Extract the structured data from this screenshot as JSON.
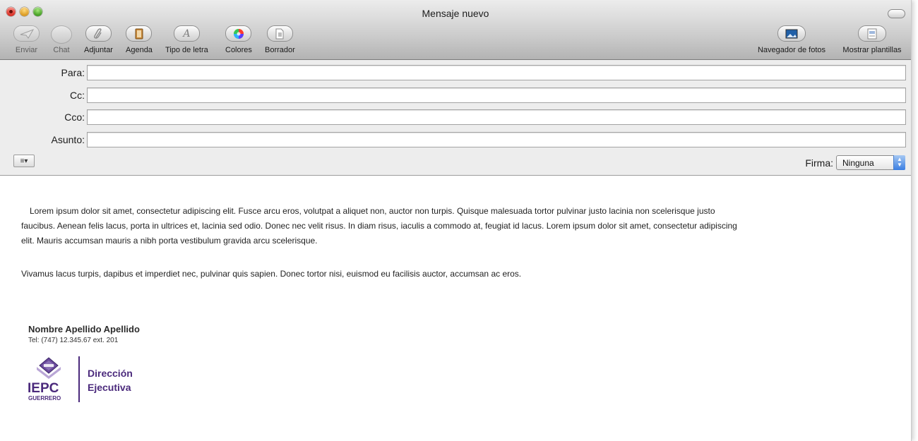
{
  "window": {
    "title": "Mensaje nuevo"
  },
  "toolbar": {
    "left": [
      {
        "label": "Enviar",
        "icon": "paper-plane-icon",
        "enabled": false
      },
      {
        "label": "Chat",
        "icon": "chat-bubble-icon",
        "enabled": false
      },
      {
        "label": "Adjuntar",
        "icon": "paperclip-icon",
        "enabled": true
      },
      {
        "label": "Agenda",
        "icon": "address-book-icon",
        "enabled": true
      },
      {
        "label": "Tipo de letra",
        "icon": "font-icon",
        "enabled": true
      },
      {
        "label": "Colores",
        "icon": "color-wheel-icon",
        "enabled": true
      },
      {
        "label": "Borrador",
        "icon": "draft-document-icon",
        "enabled": true
      }
    ],
    "right": [
      {
        "label": "Navegador de fotos",
        "icon": "photo-browser-icon",
        "enabled": true
      },
      {
        "label": "Mostrar plantillas",
        "icon": "templates-icon",
        "enabled": true
      }
    ]
  },
  "headers": {
    "to_label": "Para:",
    "to_value": "",
    "cc_label": "Cc:",
    "cc_value": "",
    "bcc_label": "Cco:",
    "bcc_value": "",
    "subject_label": "Asunto:",
    "subject_value": "",
    "format_button": "≡▾",
    "signature_label": "Firma:",
    "signature_value": "Ninguna"
  },
  "body": {
    "paragraph1": "Lorem ipsum dolor sit amet, consectetur adipiscing elit. Fusce arcu eros, volutpat a aliquet non, auctor non turpis. Quisque malesuada tortor pulvinar justo lacinia non scelerisque justo faucibus. Aenean felis lacus, porta in ultrices et, lacinia sed odio. Donec nec velit risus. In diam risus, iaculis a commodo at, feugiat id lacus. Lorem ipsum dolor sit amet, consectetur adipiscing elit. Mauris accumsan mauris a nibh porta vestibulum gravida arcu scelerisque.",
    "paragraph2": "Vivamus lacus turpis, dapibus et imperdiet nec, pulvinar quis sapien. Donec tortor nisi, euismod eu facilisis auctor, accumsan ac eros."
  },
  "signature": {
    "name": "Nombre Apellido Apellido",
    "tel": "Tel:  (747) 12.345.67   ext. 201",
    "logo_text": "IEPC",
    "logo_subtext": "GUERRERO",
    "dept_line1": "Dirección",
    "dept_line2": "Ejecutiva",
    "brand_color": "#4b2a7c"
  }
}
